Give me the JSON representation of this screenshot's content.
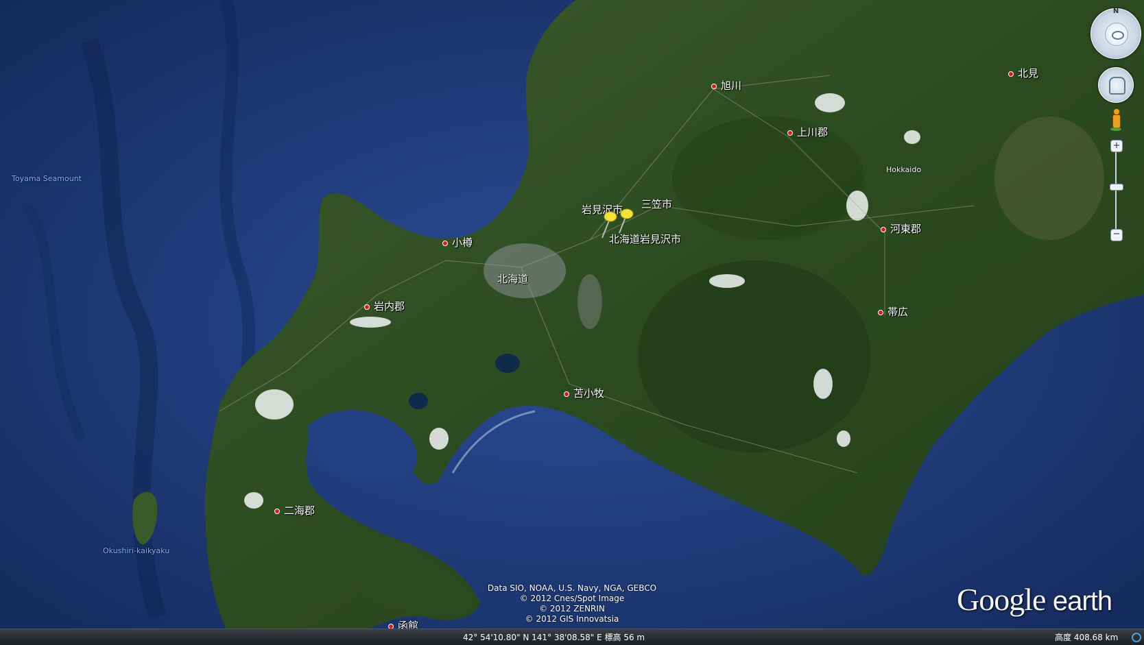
{
  "map": {
    "places": {
      "asahikawa": "旭川",
      "kitami": "北見",
      "kamikawa": "上川郡",
      "mikasa": "三笠市",
      "iwamizawa": "岩見沢市",
      "iwamizawa_full": "北海道岩見沢市",
      "otaru": "小樽",
      "hokkaido_jp": "北海道",
      "iwanai": "岩内郡",
      "tomakomai": "苫小牧",
      "kato": "河東郡",
      "obihiro": "帯広",
      "futami": "二海郡",
      "hakodate": "函館",
      "hokkaido_en": "Hokkaido"
    },
    "sea_labels": {
      "toyama_seamount": "Toyama Seamount",
      "okushiri": "Okushiri-kaikyaku"
    },
    "compass_north": "N",
    "colors": {
      "sea": "#1e3a78",
      "deep_sea": "#162d63",
      "land": "#2e4d22",
      "land_dark": "#233d1a",
      "urban": "#6f7d7a",
      "pushpin": "#f4e23a",
      "place_dot": "#d81b1b"
    },
    "icons": [
      "pushpin-icon",
      "compass-icon",
      "look-joystick-icon",
      "move-joystick-icon",
      "street-view-pegman-icon",
      "zoom-plus-icon",
      "zoom-minus-icon"
    ]
  },
  "credits": {
    "line1": "Data SIO, NOAA, U.S. Navy, NGA, GEBCO",
    "line2": "© 2012 Cnes/Spot Image",
    "line3": "© 2012 ZENRIN",
    "line4": "© 2012 GIS Innovatsia"
  },
  "logo": {
    "google": "Google",
    "earth": "earth"
  },
  "status": {
    "coordinates": "42° 54'10.80\" N 141° 38'08.58\" E 標高 56 m",
    "eye_alt": "高度 408.68 km"
  }
}
